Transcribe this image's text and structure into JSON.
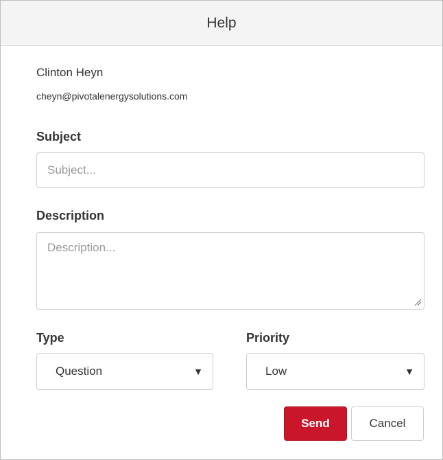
{
  "dialog": {
    "title": "Help"
  },
  "user": {
    "name": "Clinton Heyn",
    "email": "cheyn@pivotalenergysolutions.com"
  },
  "subject": {
    "label": "Subject",
    "placeholder": "Subject..."
  },
  "description": {
    "label": "Description",
    "placeholder": "Description..."
  },
  "type": {
    "label": "Type",
    "selected": "Question"
  },
  "priority": {
    "label": "Priority",
    "selected": "Low"
  },
  "actions": {
    "send_label": "Send",
    "cancel_label": "Cancel"
  },
  "colors": {
    "primary": "#c9162b",
    "header_bg": "#f4f4f4"
  }
}
